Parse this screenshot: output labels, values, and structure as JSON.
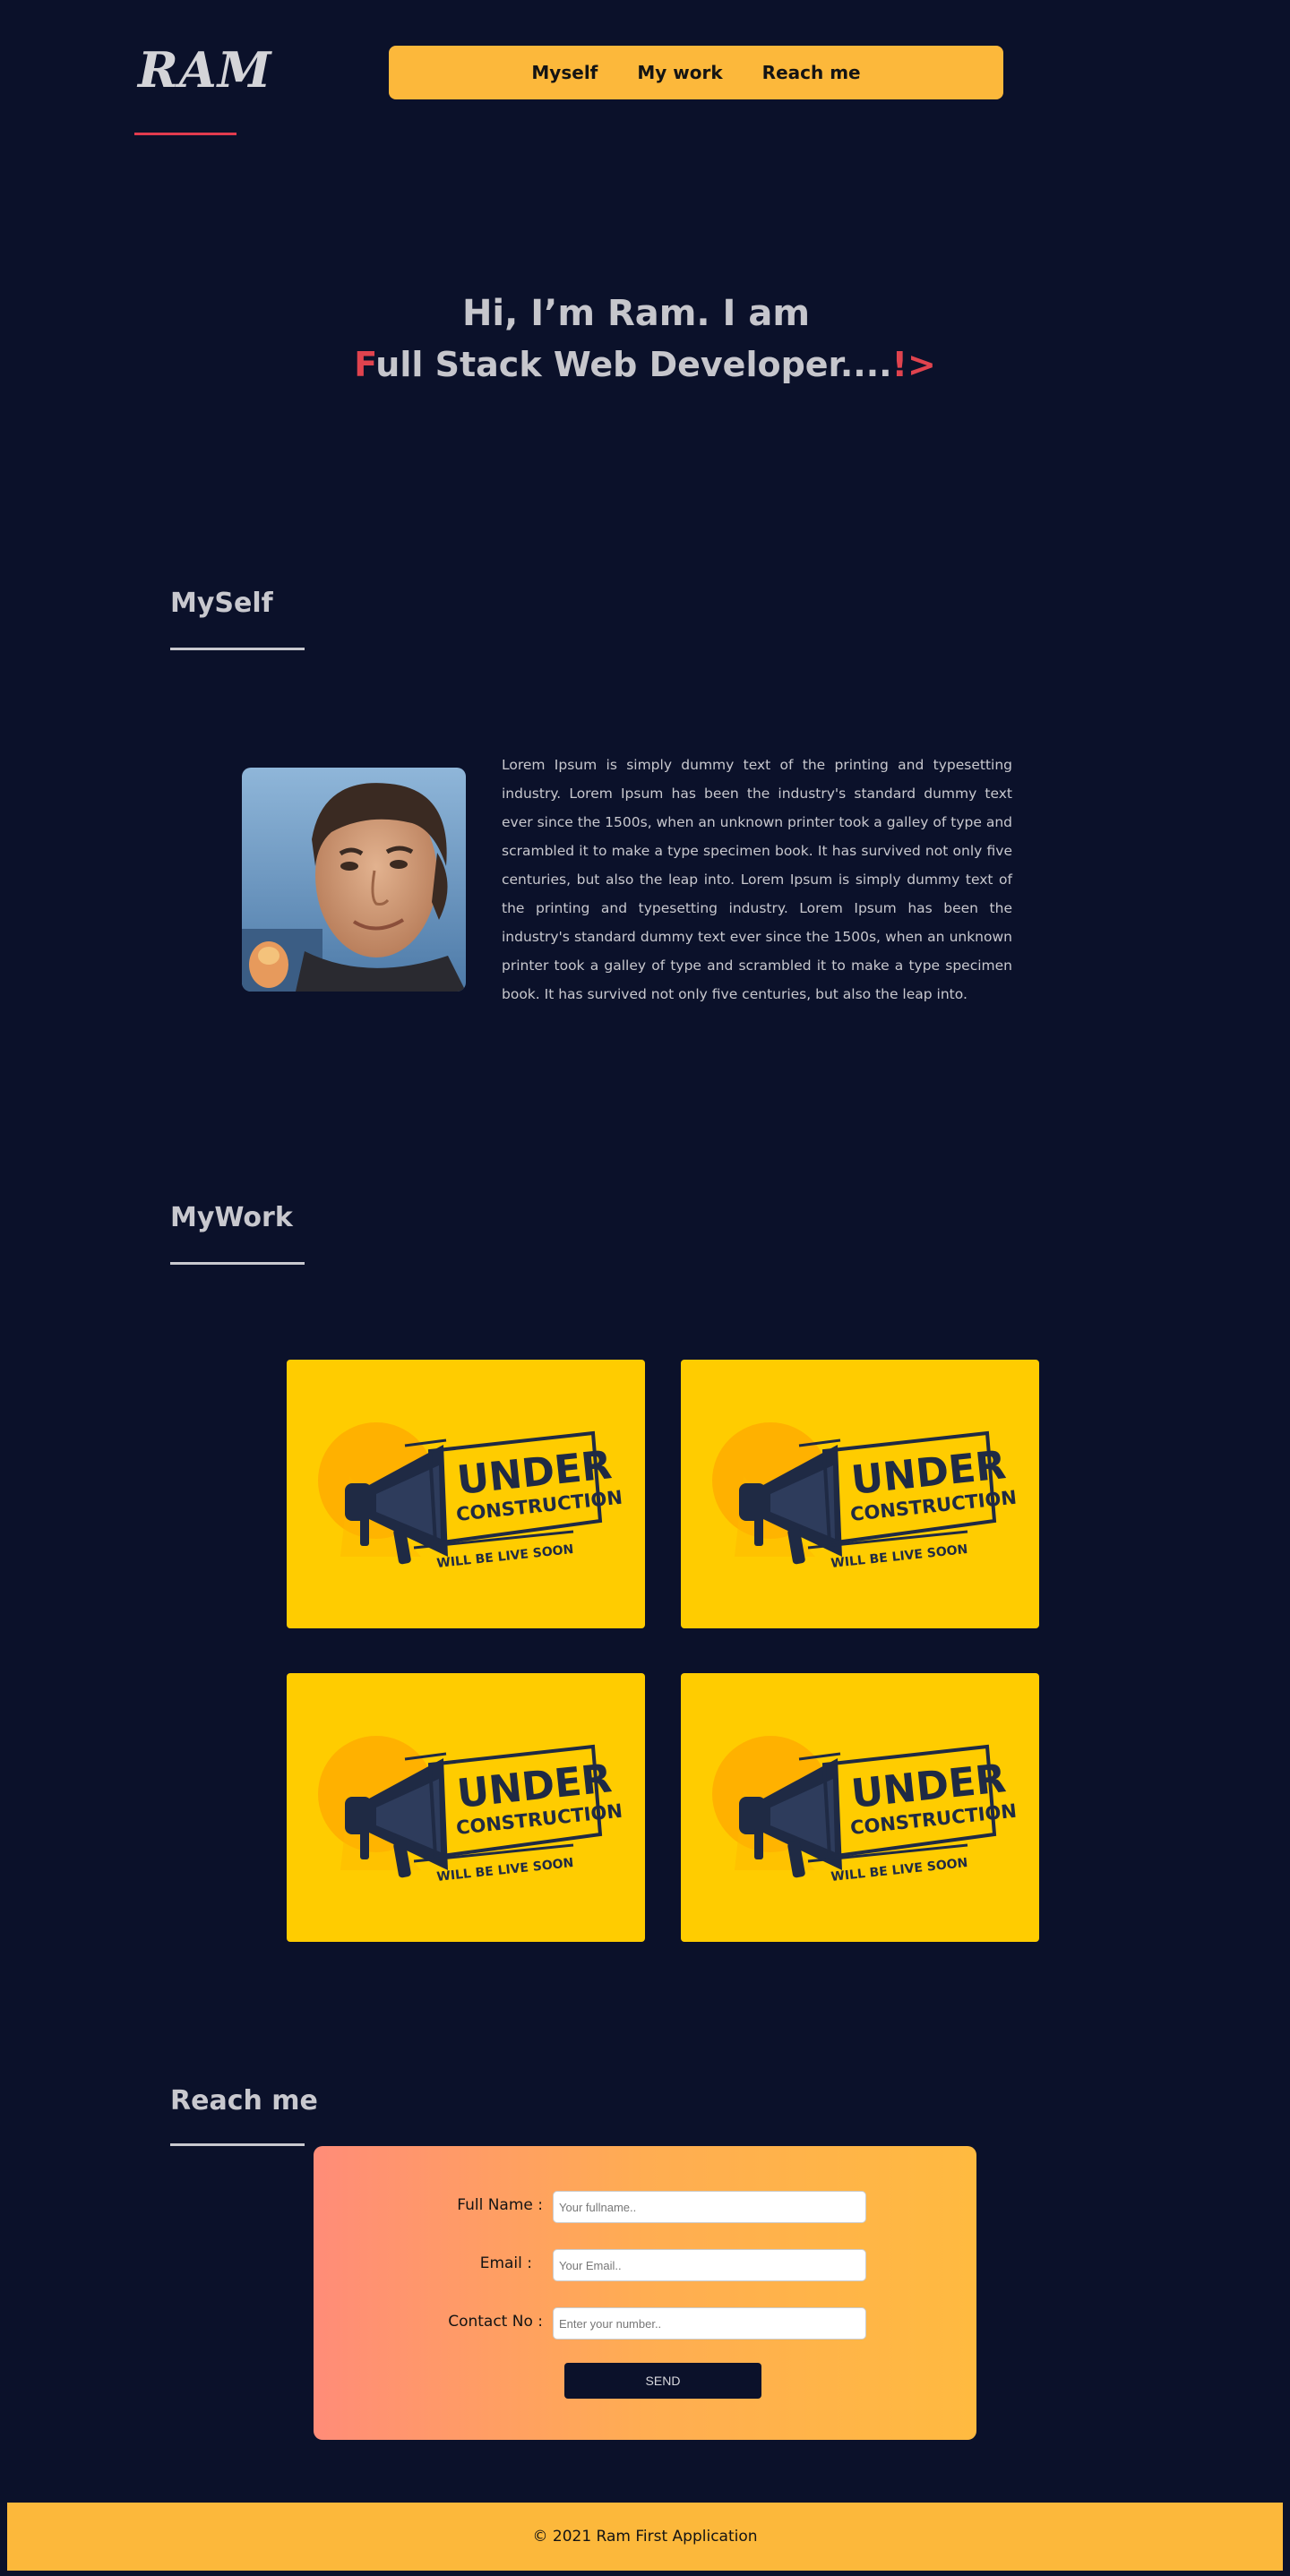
{
  "brand": {
    "logo": "RAM"
  },
  "nav": {
    "items": [
      "Myself",
      "My work",
      "Reach me"
    ]
  },
  "hero": {
    "line1": "Hi, I’m Ram. I am",
    "line2_first_letter": "F",
    "line2_rest": "ull Stack Web Developer....",
    "line2_suffix": "!>"
  },
  "myself": {
    "title": "MySelf",
    "paragraph": "Lorem Ipsum is simply dummy text of the printing and typesetting industry. Lorem Ipsum has been the industry's standard dummy text ever since the 1500s, when an unknown printer took a galley of type and scrambled it to make a type specimen book. It has survived not only five centuries, but also the leap into. Lorem Ipsum is simply dummy text of the printing and typesetting industry. Lorem Ipsum has been the industry's standard dummy text ever since the 1500s, when an unknown printer took a galley of type and scrambled it to make a type specimen book. It has survived not only five centuries, but also the leap into."
  },
  "mywork": {
    "title": "MyWork",
    "cards": [
      {
        "line1": "UNDER",
        "line2": "CONSTRUCTION",
        "line3": "WILL BE LIVE SOON"
      },
      {
        "line1": "UNDER",
        "line2": "CONSTRUCTION",
        "line3": "WILL BE LIVE SOON"
      },
      {
        "line1": "UNDER",
        "line2": "CONSTRUCTION",
        "line3": "WILL BE LIVE SOON"
      },
      {
        "line1": "UNDER",
        "line2": "CONSTRUCTION",
        "line3": "WILL BE LIVE SOON"
      }
    ]
  },
  "reach": {
    "title": "Reach me",
    "fields": [
      {
        "label": "Full Name :",
        "placeholder": "Your fullname.."
      },
      {
        "label": "Email :",
        "placeholder": "Your Email.."
      },
      {
        "label": "Contact No :",
        "placeholder": "Enter your number.."
      }
    ],
    "send_label": "SEND"
  },
  "footer": {
    "text": "© 2021 Ram First Application"
  },
  "colors": {
    "background": "#0b112a",
    "accent": "#fcb83b",
    "highlight": "#e23b4e",
    "card": "#ffcc00",
    "text": "#c8c8ce"
  }
}
